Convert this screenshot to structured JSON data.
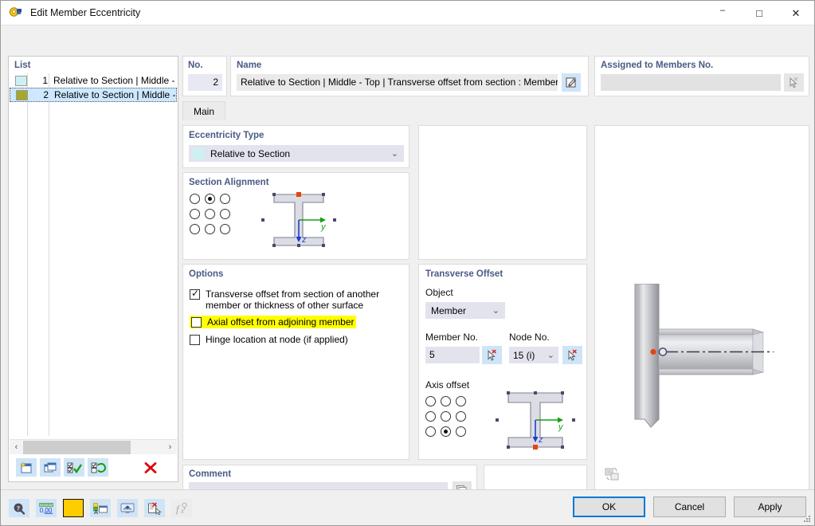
{
  "window": {
    "title": "Edit Member Eccentricity",
    "icon": "eccentricity-icon",
    "controls": {
      "minimize": "–",
      "maximize": "□",
      "close": "✕"
    }
  },
  "list": {
    "title": "List",
    "rows": [
      {
        "num": "1",
        "text": "Relative to Section | Middle - To",
        "color": "#cdf1f3",
        "selected": false
      },
      {
        "num": "2",
        "text": "Relative to Section | Middle - To",
        "color": "#a6a829",
        "selected": true
      }
    ],
    "scroll": {
      "left_arrow": "‹",
      "right_arrow": "›"
    },
    "toolbar": [
      {
        "name": "new-button"
      },
      {
        "name": "copy-button"
      },
      {
        "name": "select-all-button"
      },
      {
        "name": "invert-selection-button"
      },
      {
        "name": "delete-button"
      }
    ]
  },
  "no_panel": {
    "title": "No.",
    "value": "2"
  },
  "name_panel": {
    "title": "Name",
    "value": "Relative to Section | Middle - Top | Transverse offset from section : Member No",
    "edit_button": "edit-name-button"
  },
  "assigned_panel": {
    "title": "Assigned to Members No.",
    "value": ""
  },
  "tabs": [
    {
      "label": "Main",
      "active": true
    }
  ],
  "eccentricity_type": {
    "title": "Eccentricity Type",
    "selected": "Relative to Section",
    "swatch": "#cdf1f3"
  },
  "section_alignment": {
    "title": "Section Alignment",
    "radios": [
      [
        false,
        true,
        false
      ],
      [
        false,
        false,
        false
      ],
      [
        false,
        false,
        false
      ]
    ],
    "marker_position": "top-center"
  },
  "options": {
    "title": "Options",
    "items": [
      {
        "label": "Transverse offset from section of another member or thickness of other surface",
        "checked": true,
        "highlighted": false
      },
      {
        "label": "Axial offset from adjoining member",
        "checked": false,
        "highlighted": true
      },
      {
        "label": "Hinge location at node (if applied)",
        "checked": false,
        "highlighted": false
      }
    ]
  },
  "transverse_offset": {
    "title": "Transverse Offset",
    "object_label": "Object",
    "object_value": "Member",
    "member_label": "Member No.",
    "member_value": "5",
    "node_label": "Node No.",
    "node_value": "15 (i)",
    "axis_label": "Axis offset",
    "radios": [
      [
        false,
        false,
        false
      ],
      [
        false,
        false,
        false
      ],
      [
        false,
        true,
        false
      ]
    ],
    "marker_position": "bottom-center"
  },
  "comment": {
    "title": "Comment",
    "value": ""
  },
  "footer": {
    "tools": [
      {
        "name": "help-info-button",
        "disabled": false
      },
      {
        "name": "units-button",
        "disabled": false
      },
      {
        "name": "color-swatch-button",
        "disabled": false,
        "color": "#ffcc00"
      },
      {
        "name": "legend-button",
        "disabled": false
      },
      {
        "name": "visibility-button",
        "disabled": false
      },
      {
        "name": "delete-object-button",
        "disabled": false
      },
      {
        "name": "formula-button",
        "disabled": true
      }
    ],
    "buttons": [
      {
        "label": "OK",
        "primary": true
      },
      {
        "label": "Cancel",
        "primary": false
      },
      {
        "label": "Apply",
        "primary": false
      }
    ]
  },
  "colors": {
    "accent": "#0078d7",
    "group_title": "#4a5a85",
    "highlight": "#ffff00",
    "selection": "#cde8ff",
    "field": "#e3e3ee",
    "button_light": "#cfe4f7"
  }
}
